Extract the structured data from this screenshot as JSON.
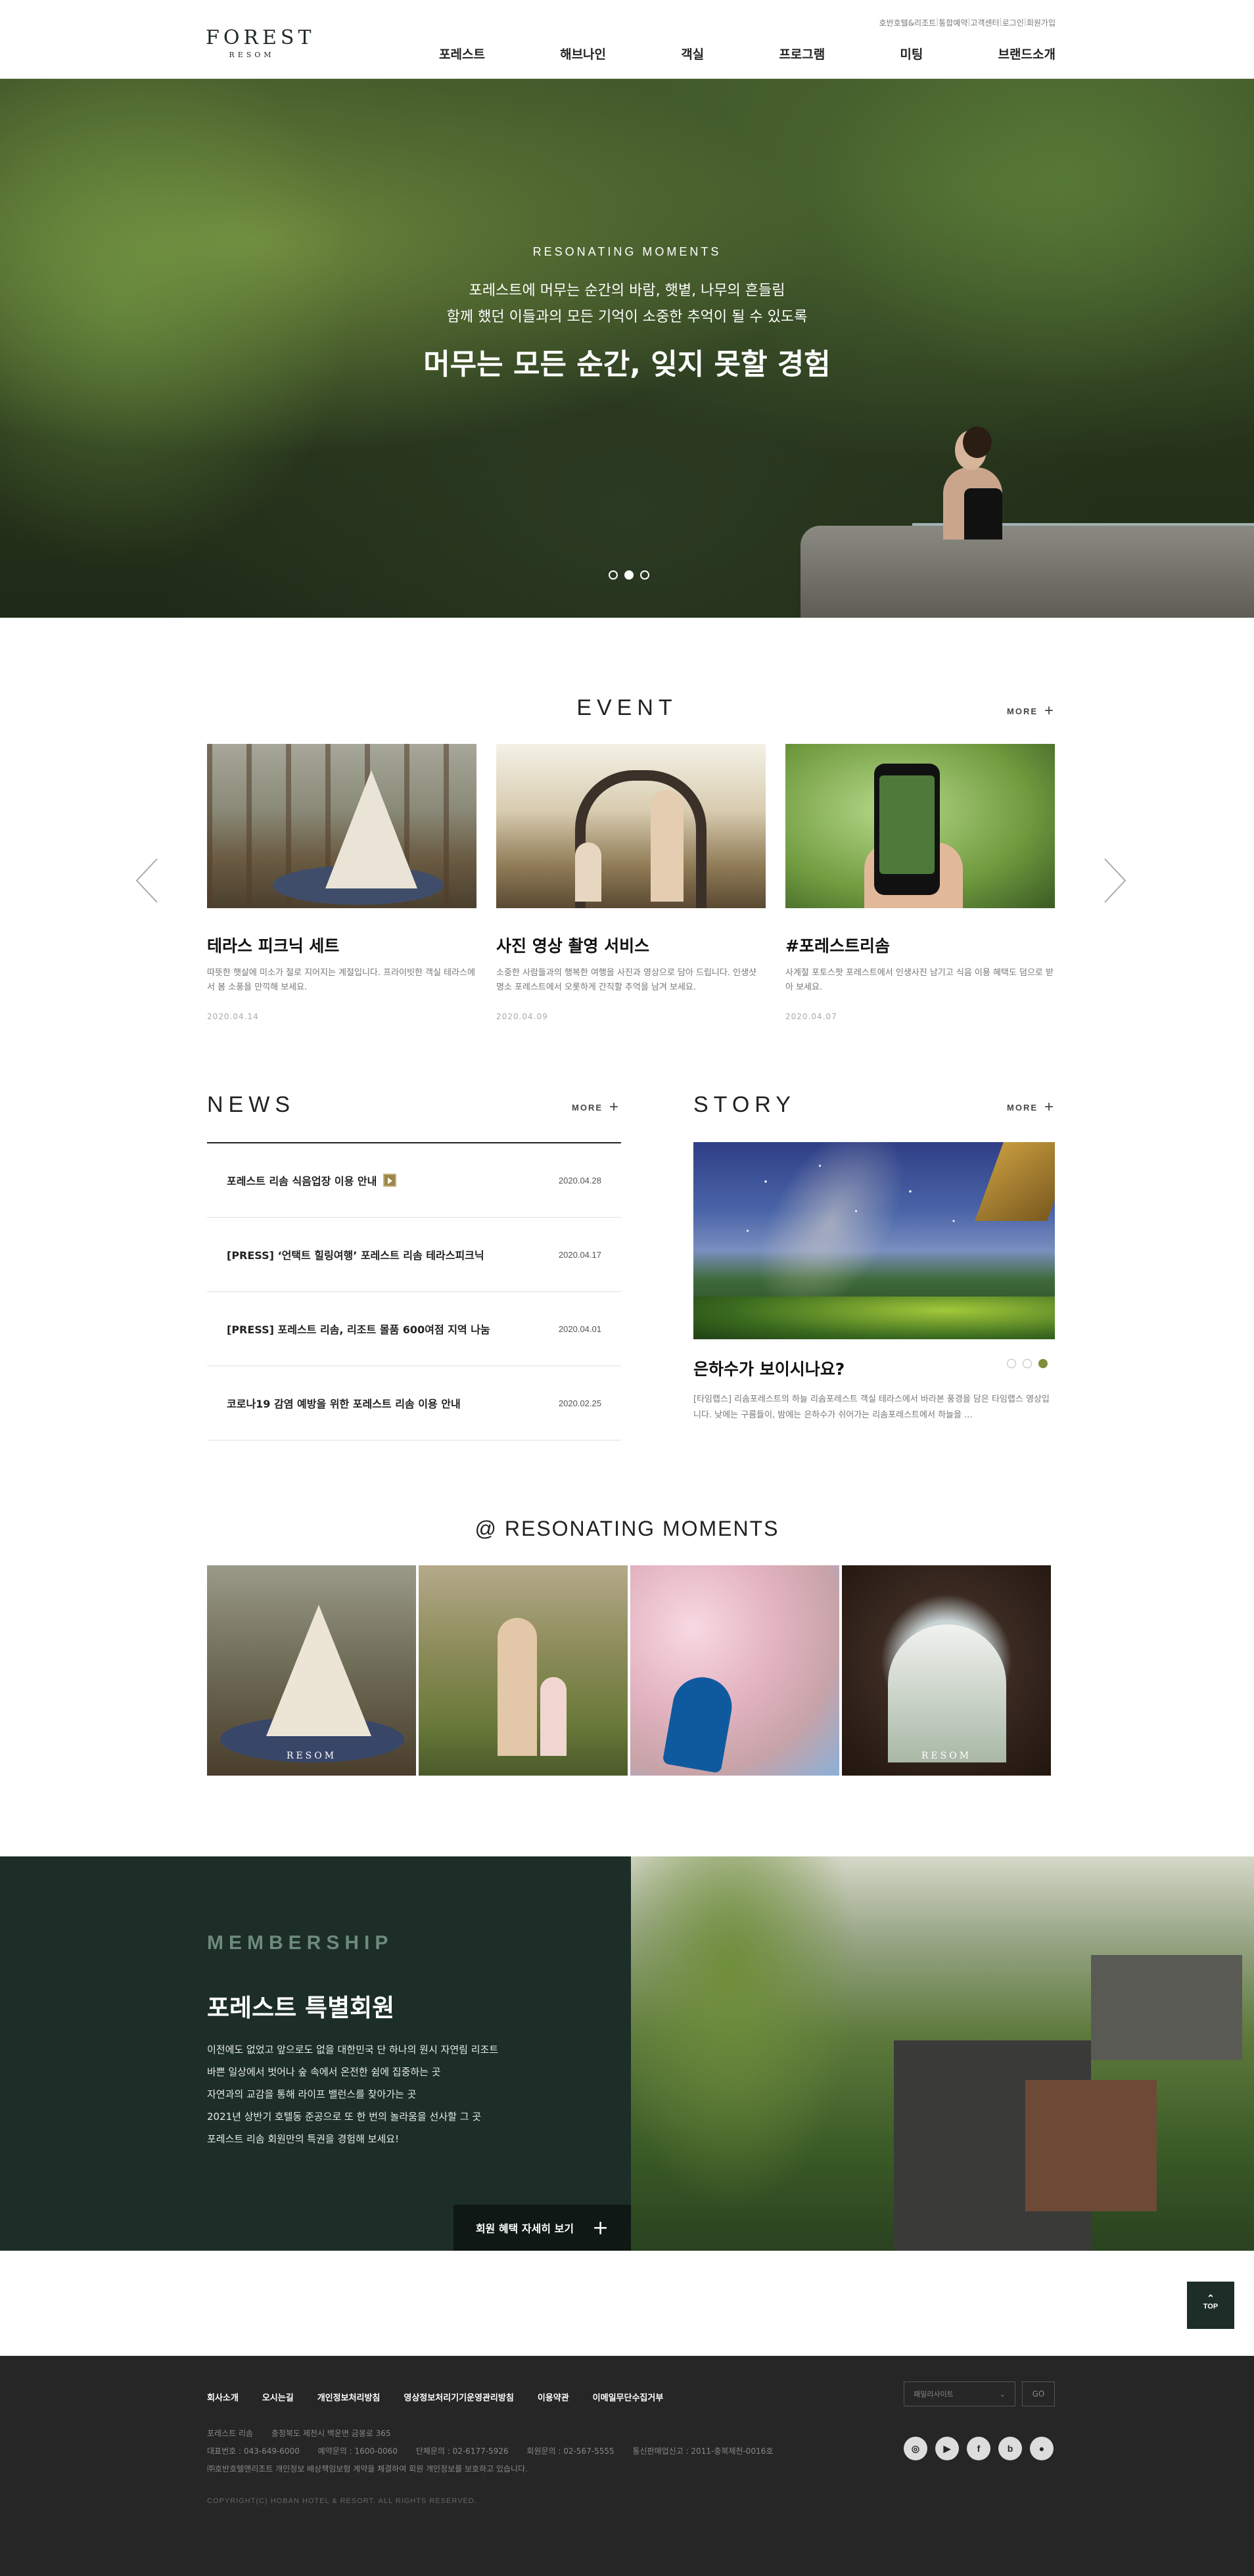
{
  "header": {
    "logo_main": "FOREST",
    "logo_sub": "RESOM",
    "util_links": [
      "호반호텔&리조트",
      "통합예약",
      "고객센터",
      "로그인",
      "회원가입"
    ],
    "nav": [
      "포레스트",
      "해브나인",
      "객실",
      "프로그램",
      "미팅",
      "브랜드소개"
    ]
  },
  "hero": {
    "kicker": "RESONATING MOMENTS",
    "sub1": "포레스트에 머무는 순간의 바람, 햇볕, 나무의 흔들림",
    "sub2": "함께 했던 이들과의 모든 기억이 소중한 추억이 될 수 있도록",
    "main": "머무는 모든 순간, 잊지 못할 경험",
    "slides": 3,
    "active_slide": 2
  },
  "event": {
    "title": "EVENT",
    "more": "MORE",
    "cards": [
      {
        "title": "테라스 피크닉 세트",
        "desc": "따뜻한 햇살에 미소가 절로 지어지는 계절입니다. 프라이빗한 객실 테라스에서 봄 소풍을 만끽해 보세요.",
        "date": "2020.04.14"
      },
      {
        "title": "사진 영상 촬영 서비스",
        "desc": "소중한 사람들과의 행복한 여행을 사진과 영상으로 담아 드립니다. 인생샷 명소 포레스트에서 오롯하게 간직할 추억을 남겨 보세요.",
        "date": "2020.04.09"
      },
      {
        "title": "#포레스트리솜",
        "desc": "사계절 포토스팟 포레스트에서 인생사진 남기고 식음 이용 혜택도 덤으로 받아 보세요.",
        "date": "2020.04.07"
      }
    ]
  },
  "news": {
    "title": "NEWS",
    "more": "MORE",
    "items": [
      {
        "title": "포레스트 리솜 식음업장 이용 안내",
        "date": "2020.04.28",
        "new": true
      },
      {
        "title": "[PRESS] ‘언택트 힐링여행’ 포레스트 리솜 테라스피크닉",
        "date": "2020.04.17",
        "new": false
      },
      {
        "title": "[PRESS] 포레스트 리솜, 리조트 몰품 600여점 지역 나눔",
        "date": "2020.04.01",
        "new": false
      },
      {
        "title": "코로나19 감염 예방을 위한 포레스트 리솜 이용 안내",
        "date": "2020.02.25",
        "new": false
      }
    ]
  },
  "story": {
    "title": "STORY",
    "more": "MORE",
    "post_title": "은하수가 보이시나요?",
    "post_desc": "[타임랩스] 리솜포레스트의 하늘 리솜포레스트 객실 테라스에서 바라본 풍경을 담은 타임랩스 영상입니다. 낮에는 구름들이, 밤에는 은하수가 쉬어가는 리솜포레스트에서 하늘을 ...",
    "slides": 3,
    "active_slide": 3
  },
  "moments": {
    "title": "@ RESONATING MOMENTS",
    "watermark": "RESOM"
  },
  "membership": {
    "kicker": "MEMBERSHIP",
    "title": "포레스트 특별회원",
    "lines": [
      "이전에도 없었고 앞으로도 없을 대한민국 단 하나의 원시 자연림 리조트",
      "바쁜 일상에서 벗어나 숲 속에서 온전한 쉼에 집중하는 곳",
      "자연과의 교감을 통해 라이프 밸런스를 찾아가는 곳",
      "2021년 상반기 호텔동 준공으로 또 한 번의 놀라움을 선사할 그 곳",
      "포레스트 리솜 회원만의 특권을 경험해 보세요!"
    ],
    "button": "회원 혜택 자세히 보기"
  },
  "top_button": "TOP",
  "footer": {
    "links": [
      "회사소개",
      "오시는길",
      "개인정보처리방침",
      "영상정보처리기기운영관리방침",
      "이용약관",
      "이메일무단수집거부"
    ],
    "family_site": "패밀리사이트",
    "go": "GO",
    "info_line1": [
      "포레스트 리솜",
      "충청북도 제천시 백운면 금봉로 365"
    ],
    "info_line2": [
      "대표번호 : 043-649-6000",
      "예약문의 : 1600-0060",
      "단체문의 : 02-6177-5926",
      "회원문의 : 02-567-5555",
      "통신판매업신고 : 2011-충북제천-0016호"
    ],
    "info_line3": "㈜호반호텔앤리조트 개인정보 배상책임보험 계약을 체결하여 회원 개인정보를 보호하고 있습니다.",
    "copyright": "COPYRIGHT(C) HOBAN HOTEL & RESORT. ALL RIGHTS RESERVED.",
    "sns": [
      "instagram-icon",
      "youtube-icon",
      "facebook-icon",
      "blog-icon",
      "kakaotalk-icon"
    ]
  }
}
